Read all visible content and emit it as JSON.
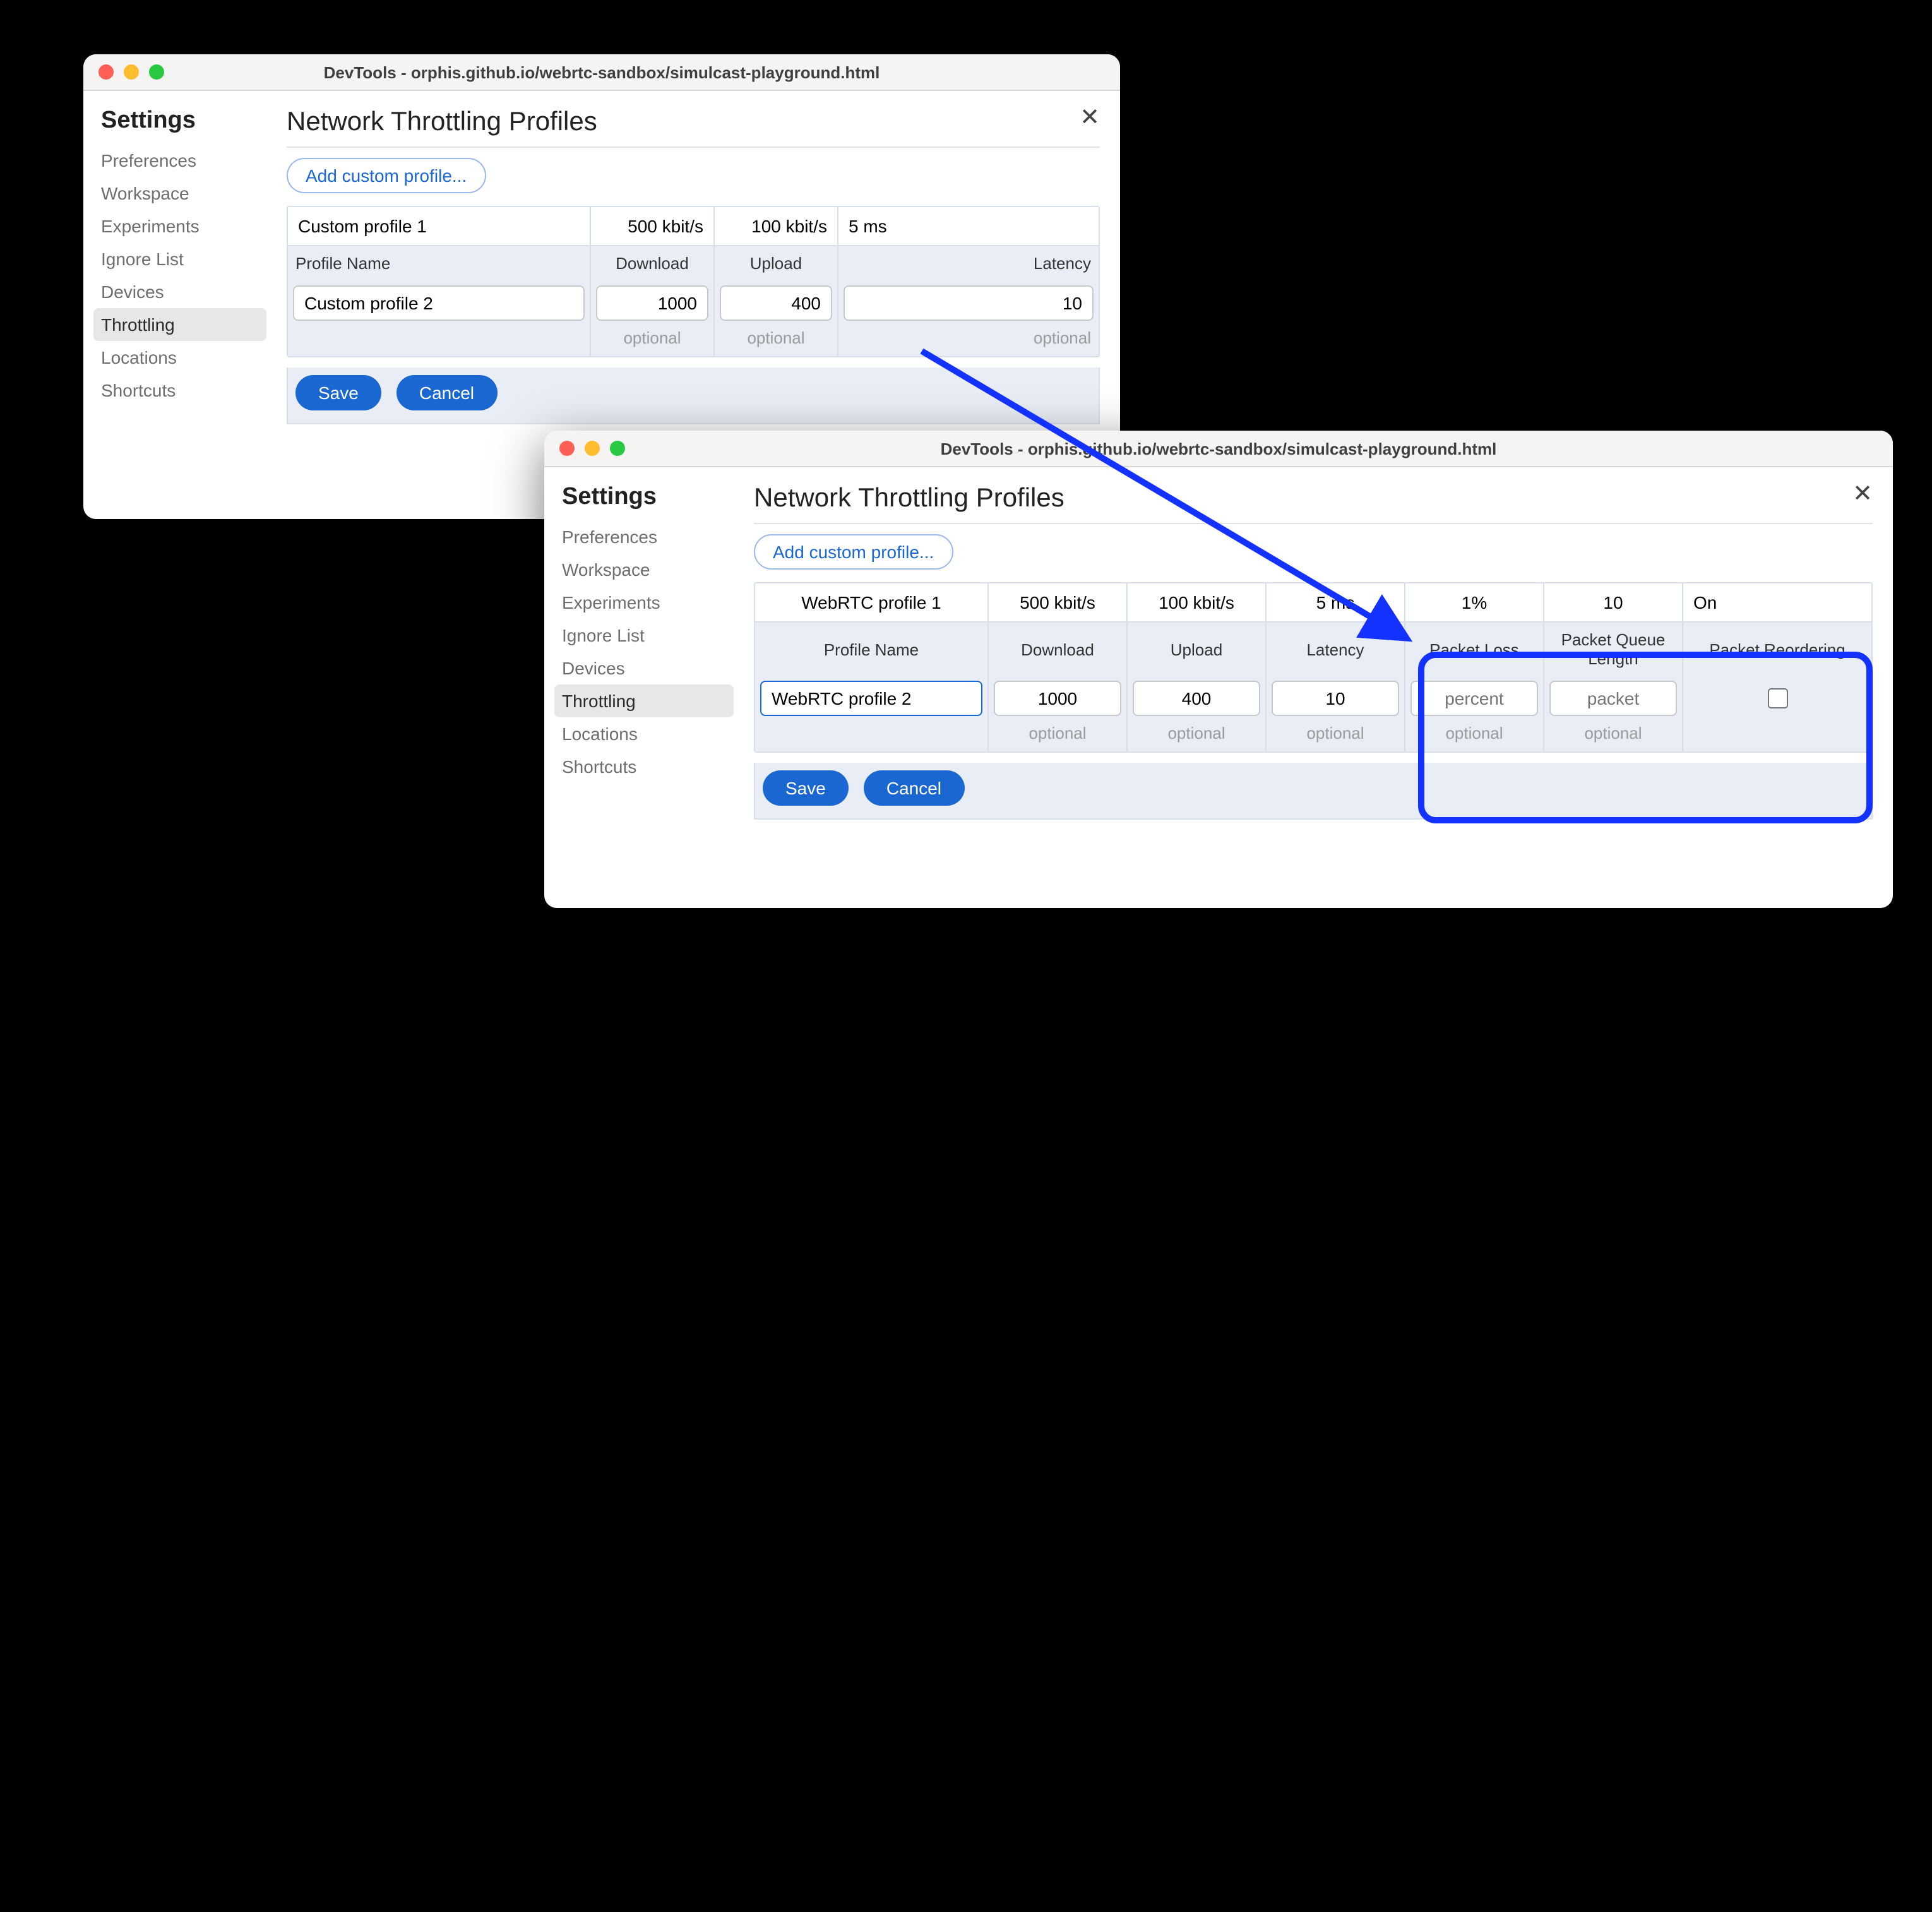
{
  "window1": {
    "title": "DevTools - orphis.github.io/webrtc-sandbox/simulcast-playground.html",
    "sidebar": {
      "heading": "Settings",
      "items": [
        "Preferences",
        "Workspace",
        "Experiments",
        "Ignore List",
        "Devices",
        "Throttling",
        "Locations",
        "Shortcuts"
      ],
      "selectedIndex": 5
    },
    "heading": "Network Throttling Profiles",
    "addButton": "Add custom profile...",
    "existing": {
      "name": "Custom profile 1",
      "download": "500 kbit/s",
      "upload": "100 kbit/s",
      "latency": "5 ms"
    },
    "headers": {
      "name": "Profile Name",
      "download": "Download",
      "upload": "Upload",
      "latency": "Latency"
    },
    "edit": {
      "name": "Custom profile 2",
      "download": "1000",
      "upload": "400",
      "latency": "10"
    },
    "optional": "optional",
    "save": "Save",
    "cancel": "Cancel"
  },
  "window2": {
    "title": "DevTools - orphis.github.io/webrtc-sandbox/simulcast-playground.html",
    "sidebar": {
      "heading": "Settings",
      "items": [
        "Preferences",
        "Workspace",
        "Experiments",
        "Ignore List",
        "Devices",
        "Throttling",
        "Locations",
        "Shortcuts"
      ],
      "selectedIndex": 5
    },
    "heading": "Network Throttling Profiles",
    "addButton": "Add custom profile...",
    "existing": {
      "name": "WebRTC profile 1",
      "download": "500 kbit/s",
      "upload": "100 kbit/s",
      "latency": "5 ms",
      "packetLoss": "1%",
      "packetQueue": "10",
      "packetReorder": "On"
    },
    "headers": {
      "name": "Profile Name",
      "download": "Download",
      "upload": "Upload",
      "latency": "Latency",
      "packetLoss": "Packet Loss",
      "packetQueue": "Packet Queue Length",
      "packetReorder": "Packet Reordering"
    },
    "edit": {
      "name": "WebRTC profile 2",
      "download": "1000",
      "upload": "400",
      "latency": "10",
      "packetLossPh": "percent",
      "packetQueuePh": "packet",
      "packetReorder": false
    },
    "optional": "optional",
    "save": "Save",
    "cancel": "Cancel"
  }
}
